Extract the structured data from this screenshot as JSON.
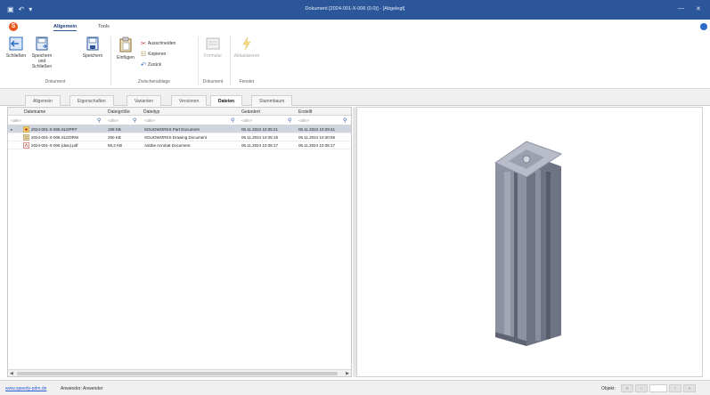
{
  "titlebar": {
    "title": "Dokument [2024-001-X-006 (0.0)] - [Abgelegt]",
    "minimize": "—",
    "close": "✕"
  },
  "ribbon": {
    "tabs": [
      "Allgemein",
      "Tools"
    ],
    "buttons": {
      "schliessen": "Schließen",
      "speichern_schliessen_1": "Speichern",
      "speichern_schliessen_2": "und Schließen",
      "speichern": "Speichern",
      "einfuegen": "Einfügen",
      "ausschneiden": "Ausschneiden",
      "kopieren": "Kopieren",
      "zurueck": "Zurück",
      "formular": "Formular",
      "aktualisieren": "Aktualisieren"
    },
    "groups": [
      "Dokument",
      "Zwischenablage",
      "Dokument",
      "Fenster"
    ]
  },
  "doctabs": [
    "Allgemein",
    "Eigenschaften",
    "Varianten",
    "Versionen",
    "Dateien",
    "Stammbaum"
  ],
  "active_doctab": "Dateien",
  "grid": {
    "columns": [
      "Dateiname",
      "Dateigröße",
      "Dateityp",
      "Geändert",
      "Erstellt"
    ],
    "filter_placeholder": "<alle>",
    "rows": [
      {
        "name": "2024-001-X-006.SLDPRT",
        "size": "198 KB",
        "type": "SOLIDWORKS Part Document",
        "changed": "06.11.2024 10:35:21",
        "created": "06.11.2024 10:29:41",
        "selected": true,
        "icon": "sldprt-file-icon"
      },
      {
        "name": "2024-001-X-006.SLDDRW",
        "size": "250 KB",
        "type": "SOLIDWORKS Drawing Document",
        "changed": "06.11.2024 10:35:15",
        "created": "06.11.2024 10:30:56",
        "selected": false,
        "icon": "slddrw-file-icon"
      },
      {
        "name": "2024-001-X-006 (dwu).pdf",
        "size": "58,2 KB",
        "type": "Adobe Acrobat Document",
        "changed": "06.11.2024 10:35:17",
        "created": "06.11.2024 10:35:17",
        "selected": false,
        "icon": "pdf-file-icon"
      }
    ]
  },
  "statusbar": {
    "link": "www.speedy-pdm.de",
    "user": "Anwender: Anwender",
    "pager_label": "Objekt:"
  },
  "colors": {
    "titlebar": "#2b579a",
    "selected_row": "#cfd6e2",
    "profile": "#8b90a0",
    "link": "#2a5bd7"
  }
}
